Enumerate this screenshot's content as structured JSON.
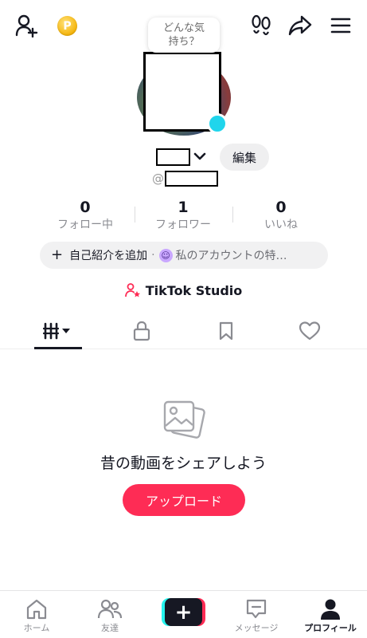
{
  "header": {
    "coin_label": "P",
    "mood_prompt": "どんな気持ち？"
  },
  "profile": {
    "edit_label": "編集",
    "handle_prefix": "@"
  },
  "stats": [
    {
      "value": "0",
      "label": "フォロー中"
    },
    {
      "value": "1",
      "label": "フォロワー"
    },
    {
      "value": "0",
      "label": "いいね"
    }
  ],
  "bio": {
    "add_label": "自己紹介を追加",
    "separator": "·",
    "account_hint": "私のアカウントの特…"
  },
  "studio": {
    "label": "TikTok Studio"
  },
  "tabs": [
    "videos-grid-icon",
    "lock-icon",
    "bookmark-icon",
    "heart-icon"
  ],
  "empty_state": {
    "title": "昔の動画をシェアしよう",
    "upload_label": "アップロード"
  },
  "bottom_nav": [
    {
      "label": "ホーム",
      "icon": "home-icon"
    },
    {
      "label": "友達",
      "icon": "friends-icon"
    },
    {
      "label": "",
      "icon": "create-plus-icon"
    },
    {
      "label": "メッセージ",
      "icon": "message-icon"
    },
    {
      "label": "プロフィール",
      "icon": "profile-icon"
    }
  ],
  "colors": {
    "accent": "#fe2c55",
    "cyan": "#25f4ee",
    "text": "#161823",
    "muted": "#8a8b91"
  }
}
